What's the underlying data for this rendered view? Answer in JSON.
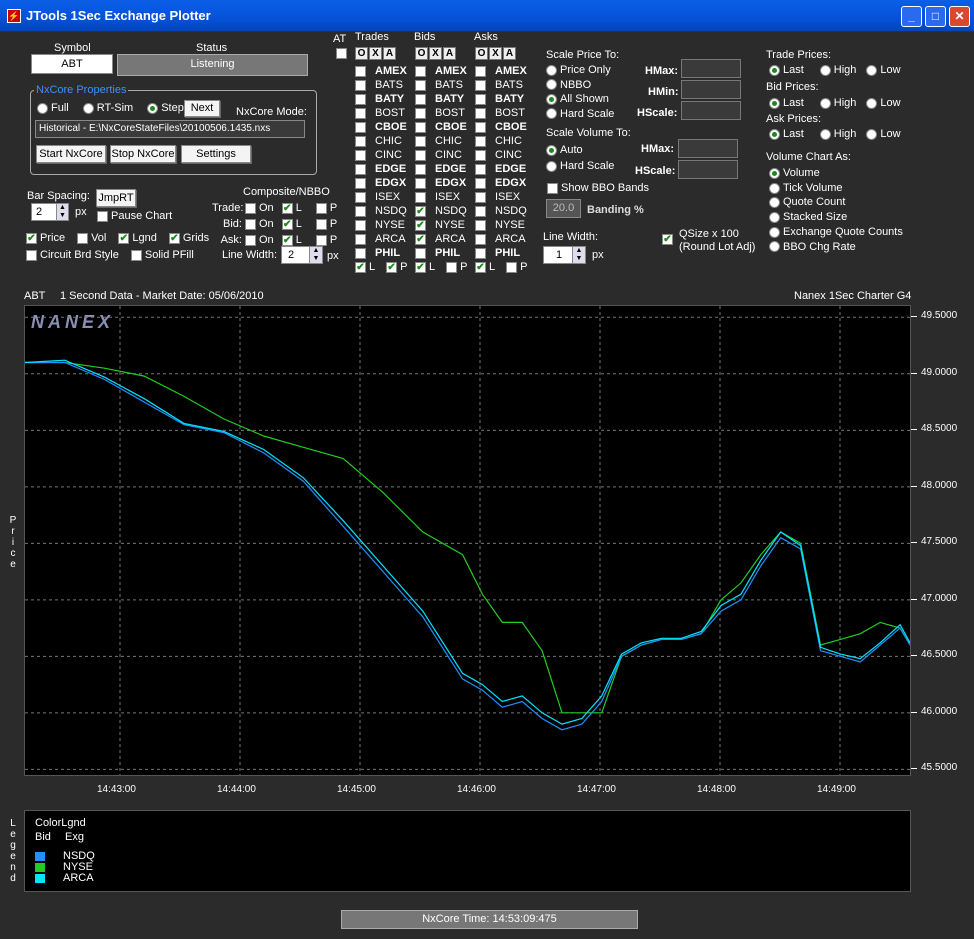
{
  "window": {
    "title": "JTools 1Sec Exchange Plotter",
    "min_icon": "_",
    "max_icon": "□",
    "close_icon": "✕"
  },
  "symbol": {
    "label": "Symbol",
    "value": "ABT"
  },
  "status": {
    "label": "Status",
    "value": "Listening"
  },
  "nxcore": {
    "group_label": "NxCore Properties",
    "modes": [
      "Full",
      "RT-Sim",
      "Step"
    ],
    "selected_mode": "Step",
    "next_label": "Next",
    "mode_caption": "NxCore Mode:",
    "mode_value": "Historical - E:\\NxCoreStateFiles\\20100506.1435.nxs",
    "start_label": "Start NxCore",
    "stop_label": "Stop NxCore",
    "settings_label": "Settings"
  },
  "bar_spacing": {
    "label": "Bar Spacing:",
    "value": "2",
    "unit": "px",
    "jmprt_label": "JmpRT",
    "pause_label": "Pause Chart"
  },
  "options": {
    "price": "Price",
    "vol": "Vol",
    "lgnd": "Lgnd",
    "grids": "Grids",
    "circuit": "Circuit Brd Style",
    "solid": "Solid PFill"
  },
  "composite": {
    "title": "Composite/NBBO",
    "rows": [
      "Trade:",
      "Bid:",
      "Ask:"
    ],
    "on": "On",
    "l": "L",
    "p": "P",
    "line_width_label": "Line Width:",
    "line_width_value": "2",
    "unit": "px"
  },
  "exchanges": {
    "at_label": "AT",
    "trades_label": "Trades",
    "bids_label": "Bids",
    "asks_label": "Asks",
    "oxa": [
      "O",
      "X",
      "A"
    ],
    "names": [
      "AMEX",
      "BATS",
      "BATY",
      "BOST",
      "CBOE",
      "CHIC",
      "CINC",
      "EDGE",
      "EDGX",
      "ISEX",
      "NSDQ",
      "NYSE",
      "ARCA",
      "PHIL"
    ],
    "bold": [
      true,
      false,
      true,
      false,
      true,
      false,
      false,
      true,
      true,
      false,
      false,
      false,
      false,
      true
    ],
    "bids_checked": [
      "NSDQ",
      "NYSE",
      "ARCA"
    ],
    "l": "L",
    "p": "P"
  },
  "scale_price": {
    "title": "Scale Price To:",
    "options": [
      "Price Only",
      "NBBO",
      "All Shown",
      "Hard Scale"
    ],
    "selected": "All Shown",
    "hmax": "HMax:",
    "hmin": "HMin:",
    "hscale": "HScale:"
  },
  "scale_volume": {
    "title": "Scale Volume To:",
    "options": [
      "Auto",
      "Hard Scale"
    ],
    "selected": "Auto",
    "hmax": "HMax:",
    "hscale": "HScale:",
    "show_bbo": "Show BBO Bands",
    "banding_value": "20.0",
    "banding_label": "Banding %"
  },
  "line_width2": {
    "label": "Line Width:",
    "value": "1",
    "unit": "px"
  },
  "qsize": {
    "label": "QSize x 100",
    "sub": "(Round Lot Adj)"
  },
  "trade_prices": {
    "title": "Trade Prices:",
    "options": [
      "Last",
      "High",
      "Low"
    ],
    "selected": "Last"
  },
  "bid_prices": {
    "title": "Bid Prices:",
    "options": [
      "Last",
      "High",
      "Low"
    ],
    "selected": "Last"
  },
  "ask_prices": {
    "title": "Ask Prices:",
    "options": [
      "Last",
      "High",
      "Low"
    ],
    "selected": "Last"
  },
  "volume_chart": {
    "title": "Volume Chart As:",
    "options": [
      "Volume",
      "Tick Volume",
      "Quote Count",
      "Stacked Size",
      "Exchange Quote Counts",
      "BBO Chg Rate"
    ],
    "selected": "Volume"
  },
  "chart_header": {
    "symbol": "ABT",
    "desc": "1 Second Data - Market Date: 05/06/2010",
    "brand": "Nanex 1Sec Charter G4",
    "watermark": "NANEX",
    "price_axis": "Price",
    "legend_axis": "Legend"
  },
  "legend": {
    "title": "ColorLgnd",
    "col1": "Bid",
    "col2": "Exg",
    "items": [
      {
        "name": "NSDQ",
        "color": "#1e90ff"
      },
      {
        "name": "NYSE",
        "color": "#22cc22"
      },
      {
        "name": "ARCA",
        "color": "#00e5ff"
      }
    ]
  },
  "status_bar": {
    "text": "NxCore Time: 14:53:09:475"
  },
  "chart_data": {
    "type": "line",
    "ylim": [
      45.45,
      49.6
    ],
    "yticks": [
      "49.5000",
      "49.0000",
      "48.5000",
      "48.0000",
      "47.5000",
      "47.0000",
      "46.5000",
      "46.0000",
      "45.5000"
    ],
    "xticks": [
      "14:43:00",
      "14:44:00",
      "14:45:00",
      "14:46:00",
      "14:47:00",
      "14:48:00",
      "14:49:00"
    ],
    "xlim": [
      0,
      445
    ],
    "series": [
      {
        "name": "NYSE",
        "color": "#22cc22",
        "x": [
          0,
          20,
          40,
          60,
          80,
          100,
          120,
          140,
          160,
          180,
          200,
          220,
          230,
          240,
          250,
          260,
          270,
          280,
          290,
          300,
          310,
          320,
          330,
          340,
          350,
          360,
          370,
          380,
          390,
          400,
          410,
          420,
          430,
          440,
          445
        ],
        "y": [
          49.1,
          49.1,
          49.05,
          48.98,
          48.8,
          48.6,
          48.45,
          48.35,
          48.25,
          47.95,
          47.6,
          47.4,
          47.05,
          46.8,
          46.8,
          46.55,
          46.0,
          46.0,
          46.0,
          46.5,
          46.6,
          46.65,
          46.65,
          46.7,
          47.0,
          47.15,
          47.4,
          47.6,
          47.5,
          46.6,
          46.65,
          46.7,
          46.8,
          46.75,
          46.6
        ]
      },
      {
        "name": "NSDQ",
        "color": "#1e90ff",
        "x": [
          0,
          20,
          40,
          60,
          80,
          100,
          120,
          140,
          160,
          180,
          200,
          220,
          230,
          240,
          250,
          260,
          270,
          280,
          290,
          300,
          310,
          320,
          330,
          340,
          350,
          360,
          370,
          380,
          390,
          400,
          410,
          420,
          430,
          440,
          445
        ],
        "y": [
          49.1,
          49.1,
          48.95,
          48.75,
          48.55,
          48.48,
          48.3,
          48.05,
          47.65,
          47.25,
          46.85,
          46.3,
          46.2,
          46.05,
          46.1,
          45.95,
          45.85,
          45.9,
          46.1,
          46.5,
          46.6,
          46.65,
          46.65,
          46.7,
          46.9,
          47.0,
          47.3,
          47.55,
          47.45,
          46.55,
          46.5,
          46.45,
          46.6,
          46.75,
          46.6
        ]
      },
      {
        "name": "ARCA",
        "color": "#00e5ff",
        "x": [
          0,
          20,
          40,
          60,
          80,
          100,
          120,
          140,
          160,
          180,
          200,
          220,
          230,
          240,
          250,
          260,
          270,
          280,
          290,
          300,
          310,
          320,
          330,
          340,
          350,
          360,
          370,
          380,
          390,
          400,
          410,
          420,
          430,
          440,
          445
        ],
        "y": [
          49.1,
          49.12,
          48.97,
          48.78,
          48.56,
          48.49,
          48.33,
          48.08,
          47.7,
          47.3,
          46.9,
          46.35,
          46.25,
          46.1,
          46.15,
          46.0,
          45.9,
          45.95,
          46.15,
          46.52,
          46.62,
          46.66,
          46.66,
          46.72,
          46.95,
          47.05,
          47.35,
          47.6,
          47.48,
          46.58,
          46.52,
          46.48,
          46.62,
          46.78,
          46.62
        ]
      }
    ]
  }
}
